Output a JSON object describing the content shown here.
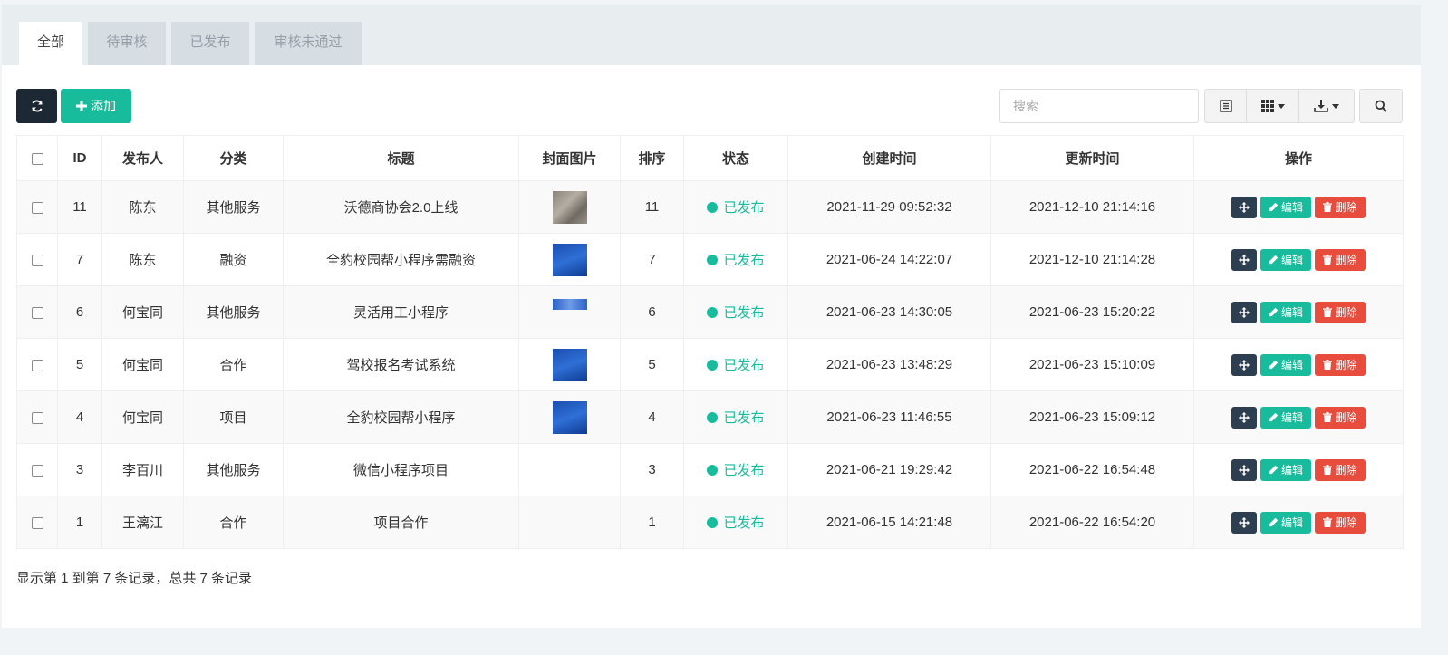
{
  "tabs": [
    "全部",
    "待审核",
    "已发布",
    "审核未通过"
  ],
  "toolbar": {
    "add_label": "添加",
    "search_placeholder": "搜索"
  },
  "columns": [
    "ID",
    "发布人",
    "分类",
    "标题",
    "封面图片",
    "排序",
    "状态",
    "创建时间",
    "更新时间",
    "操作"
  ],
  "rows": [
    {
      "id": "11",
      "publisher": "陈东",
      "category": "其他服务",
      "title": "沃德商协会2.0上线",
      "cover": "t1",
      "sort": "11",
      "status": "已发布",
      "created": "2021-11-29 09:52:32",
      "updated": "2021-12-10 21:14:16"
    },
    {
      "id": "7",
      "publisher": "陈东",
      "category": "融资",
      "title": "全豹校园帮小程序需融资",
      "cover": "t2",
      "sort": "7",
      "status": "已发布",
      "created": "2021-06-24 14:22:07",
      "updated": "2021-12-10 21:14:28"
    },
    {
      "id": "6",
      "publisher": "何宝同",
      "category": "其他服务",
      "title": "灵活用工小程序",
      "cover": "t3",
      "sort": "6",
      "status": "已发布",
      "created": "2021-06-23 14:30:05",
      "updated": "2021-06-23 15:20:22"
    },
    {
      "id": "5",
      "publisher": "何宝同",
      "category": "合作",
      "title": "驾校报名考试系统",
      "cover": "t2",
      "sort": "5",
      "status": "已发布",
      "created": "2021-06-23 13:48:29",
      "updated": "2021-06-23 15:10:09"
    },
    {
      "id": "4",
      "publisher": "何宝同",
      "category": "项目",
      "title": "全豹校园帮小程序",
      "cover": "t2",
      "sort": "4",
      "status": "已发布",
      "created": "2021-06-23 11:46:55",
      "updated": "2021-06-23 15:09:12"
    },
    {
      "id": "3",
      "publisher": "李百川",
      "category": "其他服务",
      "title": "微信小程序项目",
      "cover": "",
      "sort": "3",
      "status": "已发布",
      "created": "2021-06-21 19:29:42",
      "updated": "2021-06-22 16:54:48"
    },
    {
      "id": "1",
      "publisher": "王漓江",
      "category": "合作",
      "title": "项目合作",
      "cover": "",
      "sort": "1",
      "status": "已发布",
      "created": "2021-06-15 14:21:48",
      "updated": "2021-06-22 16:54:20"
    }
  ],
  "actions": {
    "edit": "编辑",
    "delete": "删除"
  },
  "footer": "显示第 1 到第 7 条记录，总共 7 条记录",
  "colors": {
    "accent": "#18bc9c",
    "danger": "#e74c3c",
    "dark": "#2c3e50"
  }
}
